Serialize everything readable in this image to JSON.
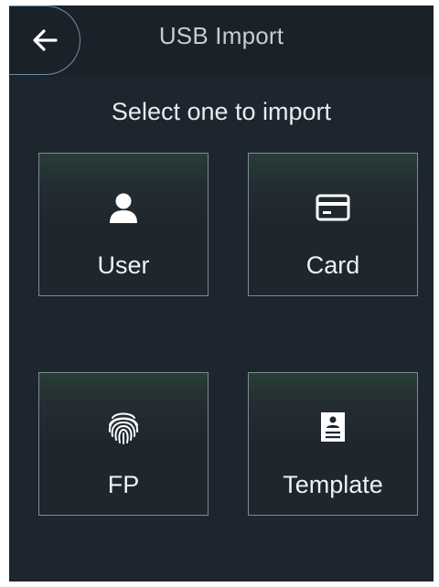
{
  "header": {
    "title": "USB Import",
    "back_icon": "arrow-left-icon"
  },
  "prompt": "Select one to import",
  "options": [
    {
      "label": "User",
      "icon": "user-icon"
    },
    {
      "label": "Card",
      "icon": "card-icon"
    },
    {
      "label": "FP",
      "icon": "fingerprint-icon"
    },
    {
      "label": "Template",
      "icon": "template-icon"
    }
  ],
  "colors": {
    "background": "#1d252e",
    "header": "#1a2129",
    "tile_border": "#7f8a96",
    "accent_ring": "#6f8fa3",
    "text": "#f0f2f4"
  }
}
